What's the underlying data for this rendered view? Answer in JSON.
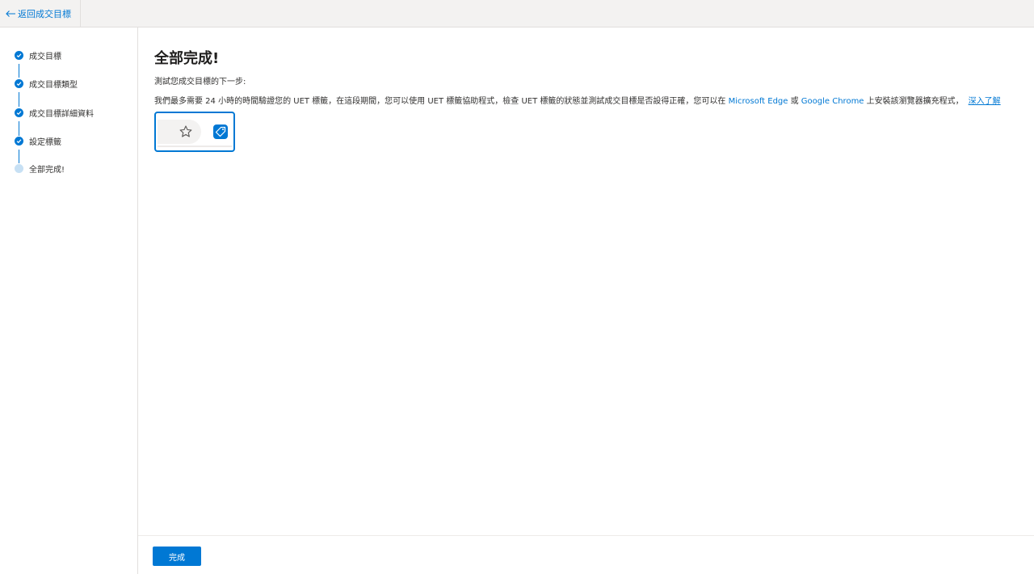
{
  "topbar": {
    "back_label": "返回成交目標",
    "back_icon": "arrow-left-icon"
  },
  "stepper": {
    "steps": [
      {
        "label": "成交目標",
        "status": "completed"
      },
      {
        "label": "成交目標類型",
        "status": "completed"
      },
      {
        "label": "成交目標詳細資料",
        "status": "completed"
      },
      {
        "label": "設定標籤",
        "status": "completed"
      },
      {
        "label": "全部完成!",
        "status": "current"
      }
    ]
  },
  "main": {
    "title": "全部完成!",
    "subtitle": "測試您成交目標的下一步:",
    "desc_part1": "我們最多需要 24 小時的時間驗證您的 UET 標籤，在這段期間，您可以使用 UET 標籤協助程式，檢查 UET 標籤的狀態並測試成交目標是否設得正確，您可以在 ",
    "link_edge": "Microsoft Edge",
    "desc_part2": " 或 ",
    "link_chrome": "Google Chrome",
    "desc_part3": " 上安裝該瀏覽器擴充程式，",
    "learn_more": "深入了解",
    "preview_icons": [
      "star-outline-icon",
      "tag-icon"
    ]
  },
  "footer": {
    "done_label": "完成"
  },
  "colors": {
    "accent": "#0078d4",
    "pending_step": "#c7e0f4",
    "topbar_bg": "#f3f2f1"
  }
}
